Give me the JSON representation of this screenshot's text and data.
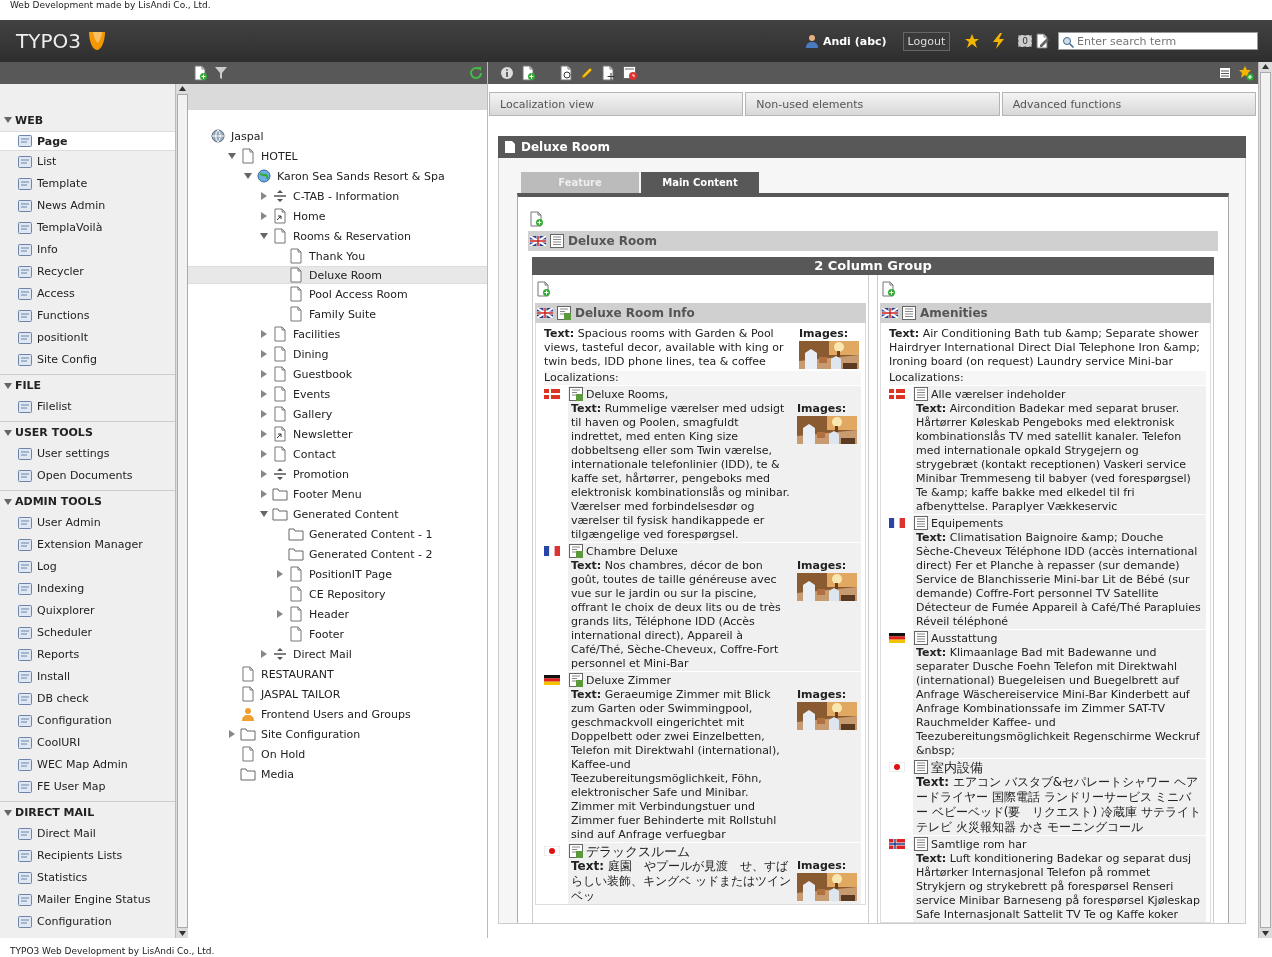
{
  "captions": {
    "top": "Web Development made by LisAndi Co., Ltd.",
    "bottom": "TYPO3 Web Development by LisAndi Co., Ltd."
  },
  "topbar": {
    "logo": "TYPO3",
    "user": "Andi (abc)",
    "logout": "Logout",
    "badge": "0",
    "search": {
      "placeholder": "Enter search term"
    }
  },
  "modules": [
    {
      "title": "WEB",
      "expanded": true,
      "items": [
        {
          "label": "Page",
          "selected": true
        },
        {
          "label": "List",
          "selected": false
        },
        {
          "label": "Template",
          "selected": false
        },
        {
          "label": "News Admin",
          "selected": false
        },
        {
          "label": "TemplaVoilà",
          "selected": false
        },
        {
          "label": "Info",
          "selected": false
        },
        {
          "label": "Recycler",
          "selected": false
        },
        {
          "label": "Access",
          "selected": false
        },
        {
          "label": "Functions",
          "selected": false
        },
        {
          "label": "positionIt",
          "selected": false
        },
        {
          "label": "Site Config",
          "selected": false
        }
      ]
    },
    {
      "title": "FILE",
      "expanded": true,
      "items": [
        {
          "label": "Filelist",
          "selected": false
        }
      ]
    },
    {
      "title": "USER TOOLS",
      "expanded": true,
      "items": [
        {
          "label": "User settings",
          "selected": false
        },
        {
          "label": "Open Documents",
          "selected": false
        }
      ]
    },
    {
      "title": "ADMIN TOOLS",
      "expanded": true,
      "items": [
        {
          "label": "User Admin",
          "selected": false
        },
        {
          "label": "Extension Manager",
          "selected": false
        },
        {
          "label": "Log",
          "selected": false
        },
        {
          "label": "Indexing",
          "selected": false
        },
        {
          "label": "Quixplorer",
          "selected": false
        },
        {
          "label": "Scheduler",
          "selected": false
        },
        {
          "label": "Reports",
          "selected": false
        },
        {
          "label": "Install",
          "selected": false
        },
        {
          "label": "DB check",
          "selected": false
        },
        {
          "label": "Configuration",
          "selected": false
        },
        {
          "label": "CoolURI",
          "selected": false
        },
        {
          "label": "WEC Map Admin",
          "selected": false
        },
        {
          "label": "FE User Map",
          "selected": false
        }
      ]
    },
    {
      "title": "DIRECT MAIL",
      "expanded": true,
      "items": [
        {
          "label": "Direct Mail",
          "selected": false
        },
        {
          "label": "Recipients Lists",
          "selected": false
        },
        {
          "label": "Statistics",
          "selected": false
        },
        {
          "label": "Mailer Engine Status",
          "selected": false
        },
        {
          "label": "Configuration",
          "selected": false
        }
      ]
    }
  ],
  "page_tree": [
    {
      "label": "Jaspal",
      "kind": "root",
      "selected": false,
      "children": [
        {
          "label": "HOTEL",
          "kind": "page",
          "expanded": true,
          "selected": false,
          "children": [
            {
              "label": "Karon Sea Sands Resort & Spa",
              "kind": "globe",
              "expanded": true,
              "selected": false,
              "children": [
                {
                  "label": "C-TAB - Information",
                  "kind": "separator",
                  "expanded": false,
                  "selected": false
                },
                {
                  "label": "Home",
                  "kind": "shortcut",
                  "expanded": false,
                  "selected": false
                },
                {
                  "label": "Rooms & Reservation",
                  "kind": "page",
                  "expanded": true,
                  "selected": false,
                  "children": [
                    {
                      "label": "Thank You",
                      "kind": "page",
                      "selected": false
                    },
                    {
                      "label": "Deluxe Room",
                      "kind": "page",
                      "selected": true
                    },
                    {
                      "label": "Pool Access Room",
                      "kind": "page",
                      "selected": false
                    },
                    {
                      "label": "Family Suite",
                      "kind": "page",
                      "selected": false
                    }
                  ]
                },
                {
                  "label": "Facilities",
                  "kind": "page",
                  "expanded": false,
                  "selected": false
                },
                {
                  "label": "Dining",
                  "kind": "page",
                  "expanded": false,
                  "selected": false
                },
                {
                  "label": "Guestbook",
                  "kind": "page",
                  "expanded": false,
                  "selected": false
                },
                {
                  "label": "Events",
                  "kind": "page",
                  "expanded": false,
                  "selected": false
                },
                {
                  "label": "Gallery",
                  "kind": "page",
                  "expanded": false,
                  "selected": false
                },
                {
                  "label": "Newsletter",
                  "kind": "shortcut",
                  "expanded": false,
                  "selected": false
                },
                {
                  "label": "Contact",
                  "kind": "page",
                  "expanded": false,
                  "selected": false
                },
                {
                  "label": "Promotion",
                  "kind": "separator",
                  "expanded": false,
                  "selected": false
                },
                {
                  "label": "Footer Menu",
                  "kind": "folder",
                  "expanded": false,
                  "selected": false
                },
                {
                  "label": "Generated Content",
                  "kind": "folder",
                  "expanded": true,
                  "selected": false,
                  "children": [
                    {
                      "label": "Generated Content - 1",
                      "kind": "folder",
                      "selected": false
                    },
                    {
                      "label": "Generated Content - 2",
                      "kind": "folder",
                      "selected": false
                    },
                    {
                      "label": "PositionIT Page",
                      "kind": "page",
                      "expanded": false,
                      "selected": false
                    },
                    {
                      "label": "CE Repository",
                      "kind": "page",
                      "selected": false
                    },
                    {
                      "label": "Header",
                      "kind": "page",
                      "expanded": false,
                      "selected": false
                    },
                    {
                      "label": "Footer",
                      "kind": "page",
                      "selected": false
                    }
                  ]
                },
                {
                  "label": "Direct Mail",
                  "kind": "separator",
                  "expanded": false,
                  "selected": false
                }
              ]
            }
          ]
        },
        {
          "label": "RESTAURANT",
          "kind": "page",
          "selected": false
        },
        {
          "label": "JASPAL TAILOR",
          "kind": "page",
          "selected": false
        },
        {
          "label": "Frontend Users and Groups",
          "kind": "users",
          "selected": false
        },
        {
          "label": "Site Configuration",
          "kind": "folder",
          "expanded": false,
          "selected": false
        },
        {
          "label": "On Hold",
          "kind": "page",
          "selected": false
        },
        {
          "label": "Media",
          "kind": "folder",
          "selected": false
        }
      ]
    }
  ],
  "tabs": [
    {
      "label": "Localization view",
      "selected": false
    },
    {
      "label": "Non-used elements",
      "selected": false
    },
    {
      "label": "Advanced functions",
      "selected": false
    }
  ],
  "page_panel": {
    "title": "Deluxe Room",
    "tabs": [
      {
        "label": "Feature",
        "selected": false
      },
      {
        "label": "Main Content",
        "selected": true
      }
    ],
    "element": {
      "flag": {
        "kind": "uk"
      },
      "title": "Deluxe Room"
    },
    "group": {
      "title": "2 Column Group",
      "columns": [
        {
          "kind": "textpic",
          "flag": {
            "kind": "uk"
          },
          "title": "Deluxe Room Info",
          "text": "**Text:** Spacious rooms with Garden & Pool views, tasteful decor, available with king or twin beds, IDD phone lines, tea & coffee",
          "images_label": "Images:",
          "localizations_label": "Localizations:",
          "localizations": [
            {
              "flag": {
                "kind": "dk"
              },
              "title": "Deluxe Rooms,",
              "text": "**Text:** Rummelige værelser med udsigt til haven og Poolen, smagfuldt indrettet, med enten King size dobbeltseng eller som Twin værelse, internationale telefonlinier (IDD), te & kaffe set, hårtørrer, pengeboks  med elektronisk kombinationslås og minibar. Værelser med forbindelsesdør og værelser til fysisk handikappede er tilgængelige ved forespørgsel.",
              "images_label": "Images:"
            },
            {
              "flag": {
                "kind": "fr"
              },
              "title": "Chambre Deluxe",
              "text": "**Text:** Nos chambres, décor de bon goût,  toutes de taille généreuse avec vue sur le jardin ou sur la piscine, offrant le choix de deux lits ou de très grands lits, Téléphone IDD (Accès international direct), Appareil à Café/Thé, Sèche-Cheveux, Coffre-Fort personnel et Mini-Bar",
              "images_label": "Images:"
            },
            {
              "flag": {
                "kind": "de"
              },
              "title": "Deluxe Zimmer",
              "text": "**Text:** Geraeumige Zimmer mit Blick zum Garten oder Swimmingpool, geschmackvoll eingerichtet mit Doppelbett oder zwei Einzelbetten, Telefon mit Direktwahl (international), Kaffee-und Teezubereitungsmöglichkeit, Föhn, elektronischer Safe und Minibar. Zimmer mit Verbindungstuer und Zimmer fuer Behinderte mit Rollstuhl sind auf Anfrage verfuegbar",
              "images_label": "Images:"
            },
            {
              "flag": {
                "kind": "jp"
              },
              "title": "デラックスルーム",
              "text": "**Text:** 庭園　やプールが見渡　せ、すばらしい装飾、キングベ ッドまたはツインベッ",
              "images_label": "Images:"
            }
          ]
        },
        {
          "kind": "text",
          "flag": {
            "kind": "uk"
          },
          "title": "Amenities",
          "text": "**Text:** Air Conditioning Bath tub &amp; Separate shower Hairdryer International Direct Dial Telephone Iron &amp; Ironing board (on request) Laundry service Mini-bar",
          "localizations_label": "Localizations:",
          "localizations": [
            {
              "flag": {
                "kind": "dk"
              },
              "title": "Alle værelser indeholder",
              "text": "**Text:** Aircondition Badekar med separat bruser. Hårtørrer Køleskab Pengeboks med elektronisk kombinationslås TV med satellit kanaler. Telefon med internationale opkald Strygejern og strygebræt (kontakt receptionen) Vaskeri service Minibar Tremmeseng til babyer (ved forespørgsel) Te &amp; kaffe bakke med elkedel til fri afbenyttelse. Paraplyer Vækkeservic"
            },
            {
              "flag": {
                "kind": "fr"
              },
              "title": "Equipements",
              "text": "**Text:** Climatisation Baignoire &amp; Douche Sèche-Cheveux Téléphone IDD (accès international direct) Fer et Planche à repasser (sur demande) Service de Blanchisserie Mini-bar Lit de Bébé (sur demande) Coffre-Fort personnel TV Satellite Détecteur de Fumée Appareil à Café/Thé Parapluies Réveil téléphoné"
            },
            {
              "flag": {
                "kind": "de"
              },
              "title": "Ausstattung",
              "text": "**Text:** Klimaanlage Bad mit Badewanne und separater Dusche Foehn Telefon mit Direktwahl (international) Buegeleisen und Buegelbrett auf Anfrage Wäschereiservice Mini-Bar Kinderbett auf Anfrage Kombinationssafe im Zimmer SAT-TV Rauchmelder Kaffee- und Teezubereitungsmöglichkeit Regenschirme Weckruf &nbsp;"
            },
            {
              "flag": {
                "kind": "jp"
              },
              "title": "室内設備",
              "text": "**Text:** エアコン バスタブ&セパレートシャワー ヘアードライヤー 国際電話 ランドリーサービス ミニバー ベビーベッド(要　リクエスト) 冷蔵庫 サテライトテレビ 火災報知器 かさ モーニングコール"
            },
            {
              "flag": {
                "kind": "no"
              },
              "title": "Samtlige rom har",
              "text": "**Text:** Luft konditionering Badekar og separat dusj Hårtørker Internasjonal Telefon på rommet Strykjern og strykebrett på forespørsel Renseri service Minibar Barneseng på forespørsel Kjøleskap Safe Internasjonalt Sattelit TV Te og Kaffe koker"
            }
          ]
        }
      ]
    }
  }
}
